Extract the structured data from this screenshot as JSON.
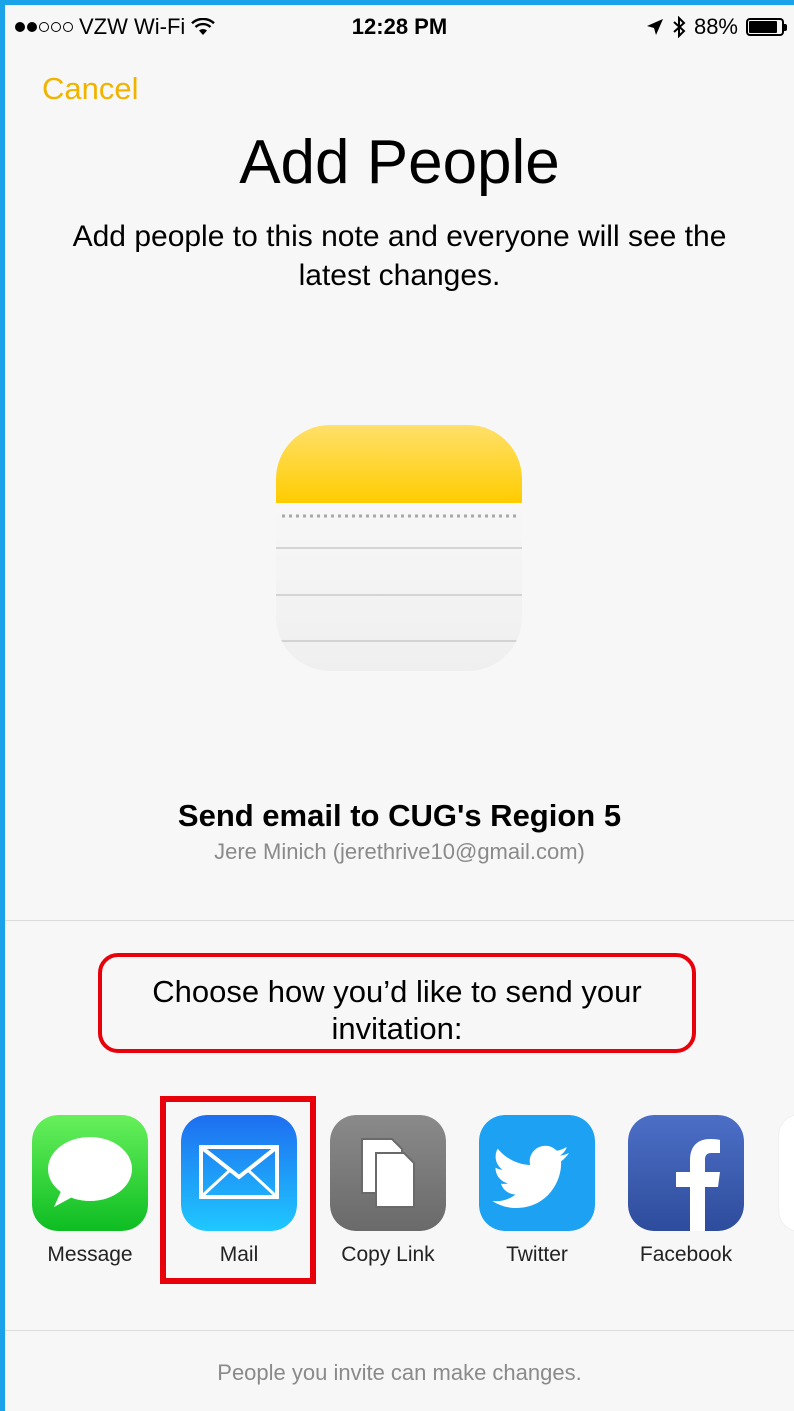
{
  "status_bar": {
    "carrier": "VZW Wi-Fi",
    "time": "12:28 PM",
    "battery": "88%",
    "battery_fraction": 0.88,
    "icons": [
      "signal-dots-icon",
      "wifi-icon",
      "location-arrow-icon",
      "bluetooth-icon",
      "battery-icon"
    ]
  },
  "header": {
    "cancel_label": "Cancel",
    "title": "Add People",
    "subtitle": "Add people to this note and everyone will see the latest changes."
  },
  "share": {
    "title": "Send email to CUG's Region 5",
    "account": "Jere Minich (jerethrive10@gmail.com)"
  },
  "choose": {
    "text": "Choose how you’d like to send your invitation:"
  },
  "apps": [
    {
      "label": "Message",
      "icon": "message-icon"
    },
    {
      "label": "Mail",
      "icon": "mail-icon"
    },
    {
      "label": "Copy Link",
      "icon": "copy-link-icon"
    },
    {
      "label": "Twitter",
      "icon": "twitter-icon"
    },
    {
      "label": "Facebook",
      "icon": "facebook-icon"
    }
  ],
  "footer": {
    "text": "People you invite can make changes."
  },
  "colors": {
    "accent": "#f0b400",
    "highlight": "#e8000b",
    "frame": "#1aa3e8"
  }
}
